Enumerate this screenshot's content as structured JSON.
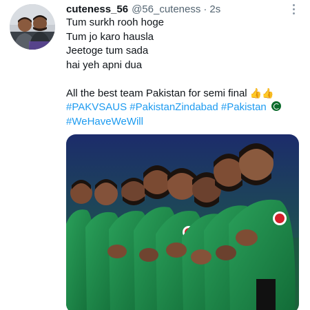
{
  "tweet": {
    "display_name": "cuteness_56",
    "handle": "@56_cuteness",
    "separator": "·",
    "time": "2s",
    "lines": [
      "Tum surkh rooh hoge",
      "Tum jo karo hausla",
      "Jeetoge tum sada",
      "hai yeh apni dua"
    ],
    "wish_text": "All the best team Pakistan for semi final",
    "hashtags_line1": [
      "#PAKVSAUS",
      "#PakistanZindabad",
      "#Pakistan"
    ],
    "hashtags_line2": [
      "#WeHaveWeWill"
    ],
    "icons": {
      "more": "more-horizontal-icon",
      "thumbs": "thumbs-up-emoji",
      "flag": "pakistan-flag-emoji"
    },
    "colors": {
      "link": "#1d9bf0",
      "text": "#0f1419",
      "muted": "#536471",
      "jersey": "#1f8a4c"
    }
  }
}
